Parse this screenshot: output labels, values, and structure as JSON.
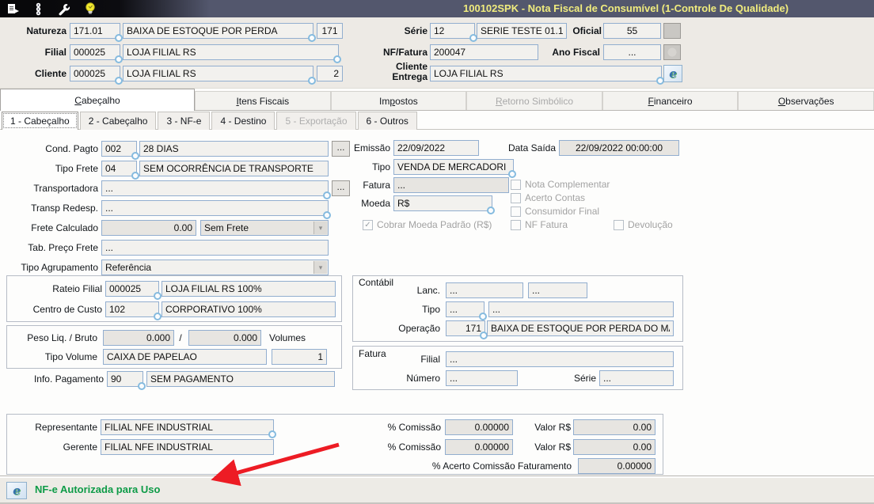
{
  "colors": {
    "titlebar_bg": "#53576d",
    "title_text": "#f0ec7e",
    "field_border": "#92aecf",
    "status_green": "#0d9b47",
    "arrow_red": "#ed1c24"
  },
  "icons": {
    "toolbar": [
      "report-export-icon",
      "traffic-light-icon",
      "wrench-icon",
      "lightbulb-icon"
    ],
    "nfe_glyph": "e",
    "combo_arrow": "▾",
    "check": "✓"
  },
  "titlebar": {
    "title": "100102SPK - Nota Fiscal de Consumível (1-Controle De Qualidade)"
  },
  "header": {
    "natureza": {
      "label": "Natureza",
      "code": "171.01",
      "desc": "BAIXA DE ESTOQUE POR PERDA",
      "cfop": "171"
    },
    "filial": {
      "label": "Filial",
      "code": "000025",
      "desc": "LOJA FILIAL RS"
    },
    "cliente": {
      "label": "Cliente",
      "code": "000025",
      "desc": "LOJA FILIAL RS",
      "loja": "2"
    },
    "serie": {
      "label": "Série",
      "code": "12",
      "desc": "SERIE TESTE 01.1"
    },
    "oficial": {
      "label": "Oficial",
      "value": "55"
    },
    "nf_fatura": {
      "label": "NF/Fatura",
      "value": "200047"
    },
    "ano_fiscal": {
      "label": "Ano Fiscal",
      "value": "..."
    },
    "cliente_entrega": {
      "label": "Cliente Entrega",
      "value": "LOJA FILIAL RS"
    }
  },
  "tabs": {
    "main": [
      {
        "label": "Cabeçalho",
        "accel": 0,
        "state": "active"
      },
      {
        "label": "Itens Fiscais",
        "accel": 0,
        "state": "normal"
      },
      {
        "label": "Impostos",
        "accel": 2,
        "state": "normal"
      },
      {
        "label": "Retorno Simbólico",
        "accel": 0,
        "state": "disabled"
      },
      {
        "label": "Financeiro",
        "accel": 0,
        "state": "normal"
      },
      {
        "label": "Observações",
        "accel": 0,
        "state": "normal"
      }
    ],
    "sub": [
      {
        "label": "1 - Cabeçalho",
        "state": "active"
      },
      {
        "label": "2 - Cabeçalho",
        "state": "normal"
      },
      {
        "label": "3 - NF-e",
        "state": "normal"
      },
      {
        "label": "4 - Destino",
        "state": "normal"
      },
      {
        "label": "5 - Exportação",
        "state": "disabled"
      },
      {
        "label": "6 - Outros",
        "state": "normal"
      }
    ]
  },
  "form": {
    "cond_pagto": {
      "label": "Cond. Pagto",
      "code": "002",
      "desc": "28 DIAS",
      "browse": "..."
    },
    "tipo_frete": {
      "label": "Tipo Frete",
      "code": "04",
      "desc": "SEM OCORRÊNCIA DE TRANSPORTE"
    },
    "transportadora": {
      "label": "Transportadora",
      "value": "...",
      "browse": "..."
    },
    "transp_redesp": {
      "label": "Transp Redesp.",
      "value": "..."
    },
    "frete_calculado": {
      "label": "Frete Calculado",
      "value": "0.00",
      "mode": "Sem Frete"
    },
    "tab_preco_frete": {
      "label": "Tab. Preço Frete",
      "value": "..."
    },
    "tipo_agrupamento": {
      "label": "Tipo Agrupamento",
      "value": "Referência"
    },
    "emissao": {
      "label": "Emissão",
      "value": "22/09/2022"
    },
    "data_saida": {
      "label": "Data Saída",
      "value": "22/09/2022 00:00:00"
    },
    "tipo": {
      "label": "Tipo",
      "value": "VENDA DE MERCADORI"
    },
    "fatura": {
      "label": "Fatura",
      "value": "..."
    },
    "moeda": {
      "label": "Moeda",
      "value": "R$"
    },
    "info_pagamento": {
      "label": "Info. Pagamento",
      "code": "90",
      "desc": "SEM PAGAMENTO"
    },
    "checkboxes": {
      "moeda_padrao": {
        "label": "Cobrar Moeda Padrão (R$)",
        "check": "✓"
      },
      "nota_complementar": {
        "label": "Nota Complementar"
      },
      "acerto_contas": {
        "label": "Acerto Contas"
      },
      "consumidor_final": {
        "label": "Consumidor Final"
      },
      "nf_fatura": {
        "label": "NF Fatura"
      },
      "devolucao": {
        "label": "Devolução"
      }
    }
  },
  "rateio": {
    "filial": {
      "label": "Rateio  Filial",
      "code": "000025",
      "desc": "LOJA FILIAL RS 100%"
    },
    "centro_custo": {
      "label": "Centro de Custo",
      "code": "102",
      "desc": "CORPORATIVO 100%"
    }
  },
  "volumes": {
    "peso": {
      "label": "Peso Liq. / Bruto",
      "liq": "0.000",
      "sep": "/",
      "bruto": "0.000"
    },
    "volumes_label": "Volumes",
    "tipo_volume": {
      "label": "Tipo Volume",
      "value": "CAIXA DE PAPELAO",
      "qty": "1"
    }
  },
  "contabil": {
    "title": "Contábil",
    "lanc": {
      "label": "Lanc.",
      "v1": "...",
      "v2": "..."
    },
    "tipo": {
      "label": "Tipo",
      "v1": "...",
      "v2": "..."
    },
    "operacao": {
      "label": "Operação",
      "code": "171",
      "desc": "BAIXA DE ESTOQUE POR PERDA DO MA"
    }
  },
  "fatura_box": {
    "title": "Fatura",
    "filial": {
      "label": "Filial",
      "value": "..."
    },
    "numero": {
      "label": "Número",
      "value": "..."
    },
    "serie": {
      "label": "Série",
      "value": "..."
    }
  },
  "comissao": {
    "representante": {
      "label": "Representante",
      "value": "FILIAL NFE INDUSTRIAL"
    },
    "gerente": {
      "label": "Gerente",
      "value": "FILIAL NFE INDUSTRIAL"
    },
    "pct1": {
      "label": "% Comissão",
      "value": "0.00000"
    },
    "valor1": {
      "label": "Valor R$",
      "value": "0.00"
    },
    "pct2": {
      "label": "% Comissão",
      "value": "0.00000"
    },
    "valor2": {
      "label": "Valor R$",
      "value": "0.00"
    },
    "acerto": {
      "label": "% Acerto Comissão Faturamento",
      "value": "0.00000"
    }
  },
  "statusbar": {
    "text": "NF-e Autorizada para Uso"
  }
}
